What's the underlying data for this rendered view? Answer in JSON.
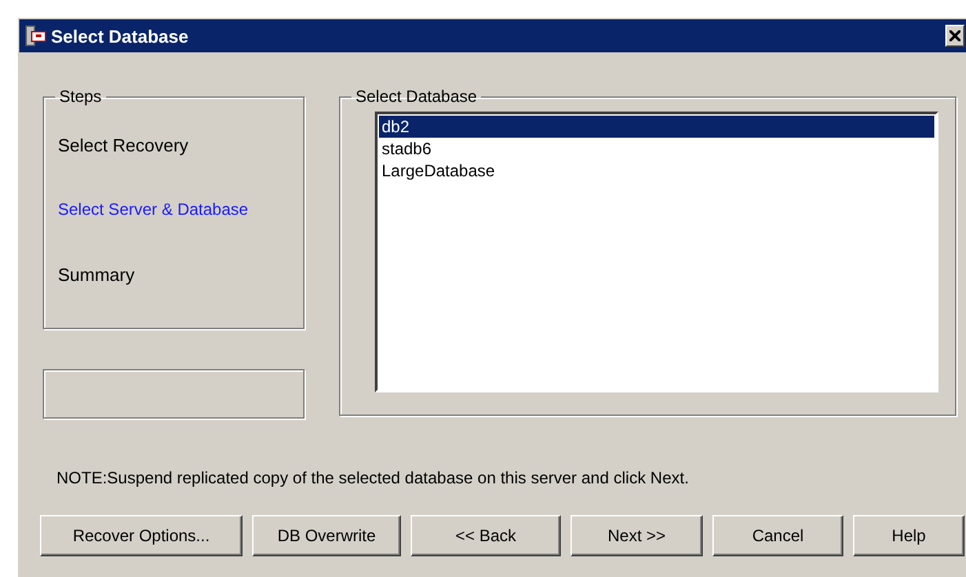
{
  "window": {
    "title": "Select Database"
  },
  "steps": {
    "title": "Steps",
    "items": [
      {
        "label": "Select Recovery",
        "selected": false
      },
      {
        "label": "Select Server & Database",
        "selected": true
      },
      {
        "label": "Summary",
        "selected": false
      }
    ]
  },
  "database_group": {
    "title": "Select Database",
    "items": [
      {
        "label": "db2",
        "selected": true
      },
      {
        "label": "stadb6",
        "selected": false
      },
      {
        "label": "LargeDatabase",
        "selected": false
      }
    ]
  },
  "note": "NOTE:Suspend replicated copy of the selected database on this server and click Next.",
  "buttons": [
    {
      "label": "Recover Options..."
    },
    {
      "label": "DB Overwrite"
    },
    {
      "label": "<< Back"
    },
    {
      "label": "Next >>"
    },
    {
      "label": "Cancel"
    },
    {
      "label": "Help"
    }
  ]
}
